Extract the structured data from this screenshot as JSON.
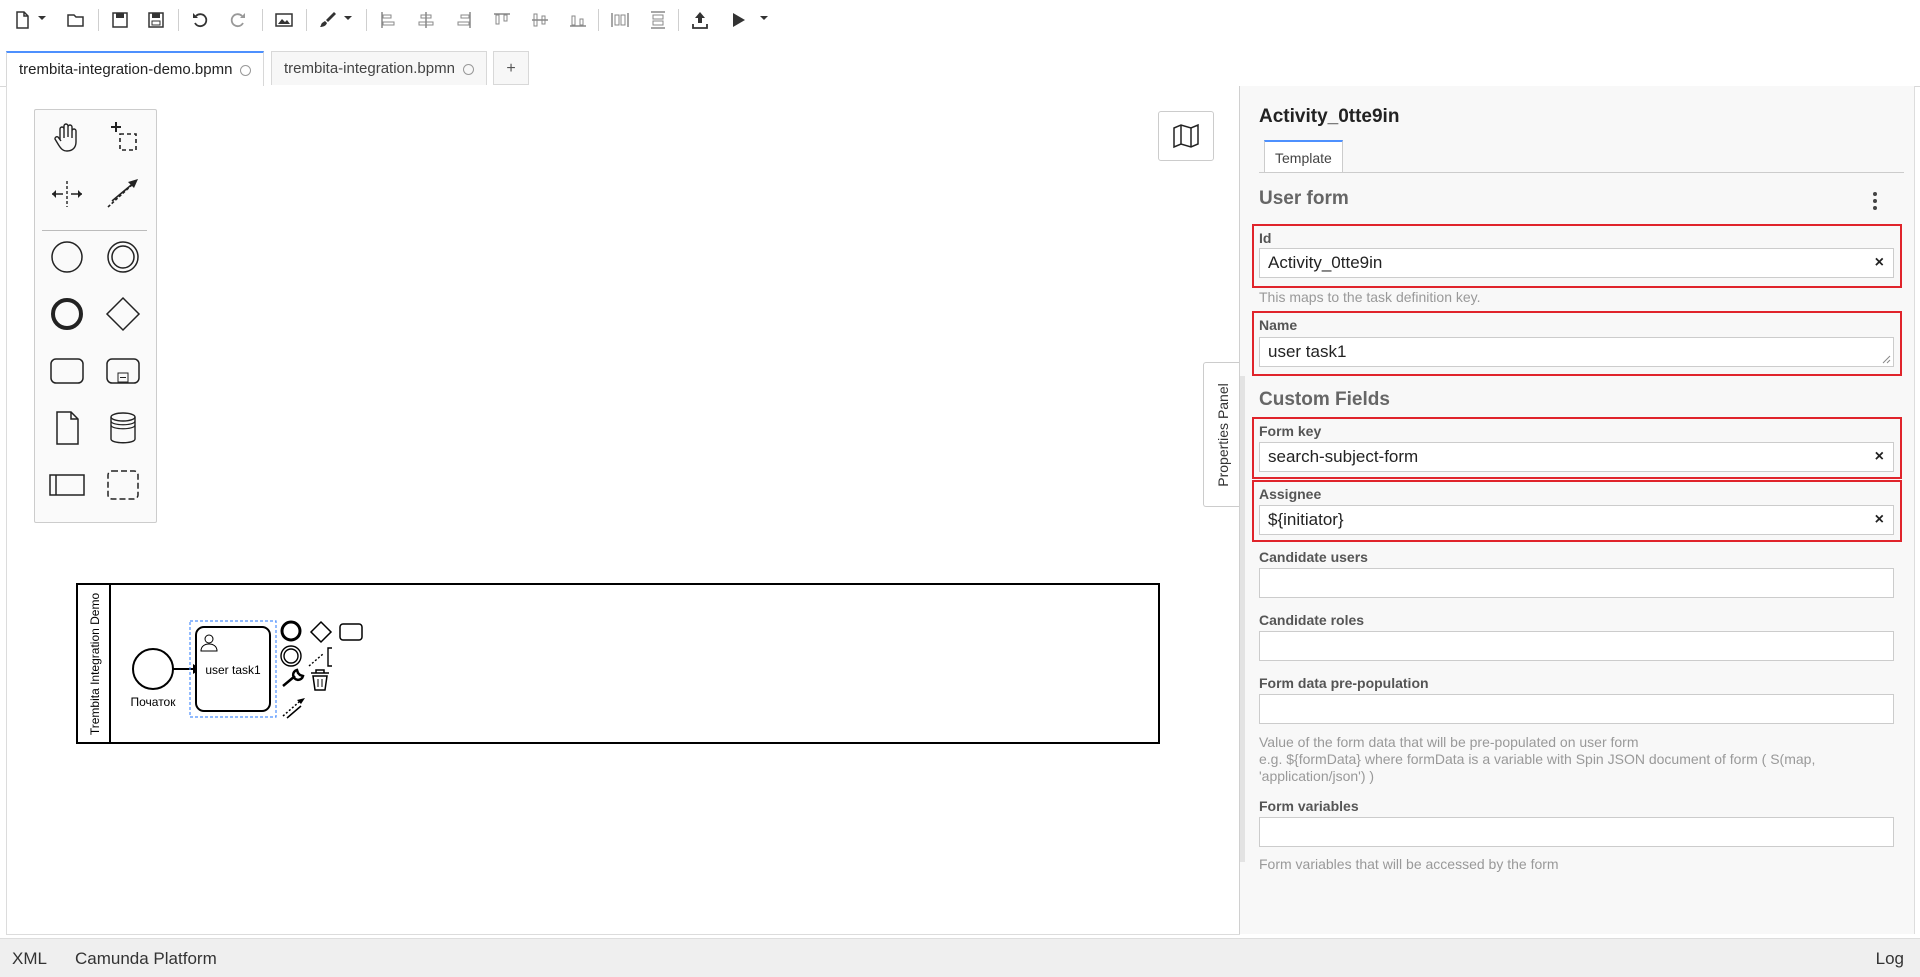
{
  "tabs": [
    {
      "label": "trembita-integration-demo.bpmn"
    },
    {
      "label": "trembita-integration.bpmn"
    }
  ],
  "tab_add_label": "+",
  "diagram": {
    "pool_label": "Trembita Integration Demo",
    "start_event_label": "Початок",
    "task_label": "user task1"
  },
  "properties_toggle_label": "Properties Panel",
  "panel": {
    "title": "Activity_0tte9in",
    "tab_label": "Template",
    "group_user_form": "User form",
    "group_custom_fields": "Custom Fields",
    "fields": {
      "id": {
        "label": "Id",
        "value": "Activity_0tte9in",
        "description": "This maps to the task definition key."
      },
      "name": {
        "label": "Name",
        "value": "user task1"
      },
      "form_key": {
        "label": "Form key",
        "value": "search-subject-form"
      },
      "assignee": {
        "label": "Assignee",
        "value": "${initiator}"
      },
      "candidate_users": {
        "label": "Candidate users",
        "value": ""
      },
      "candidate_roles": {
        "label": "Candidate roles",
        "value": ""
      },
      "form_data": {
        "label": "Form data pre-population",
        "value": "",
        "description_1": "Value of the form data that will be pre-populated on user form",
        "description_2": "e.g. ${formData} where formData is a variable with Spin JSON document of form ( S(map, 'application/json') )"
      },
      "form_variables": {
        "label": "Form variables",
        "value": "",
        "description": "Form variables that will be accessed by the form"
      }
    },
    "clear_glyph": "×"
  },
  "status": {
    "left_1": "XML",
    "left_2": "Camunda Platform",
    "right": "Log"
  },
  "colors": {
    "accent": "#4d90fe",
    "highlight": "#e0242b",
    "selection": "#4d90fe"
  }
}
